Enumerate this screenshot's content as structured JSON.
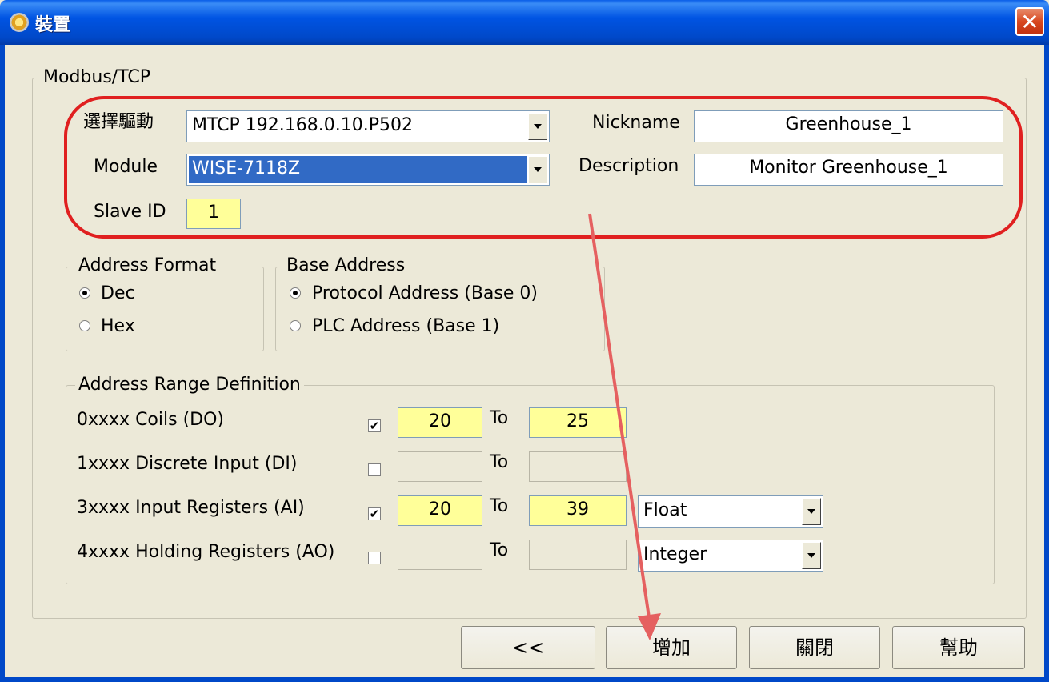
{
  "window": {
    "title": "裝置",
    "close_glyph": "✕"
  },
  "group_main": {
    "legend": "Modbus/TCP"
  },
  "driver": {
    "label": "選擇驅動",
    "value": "MTCP  192.168.0.10.P502"
  },
  "module": {
    "label": "Module",
    "value": "WISE-7118Z"
  },
  "slave": {
    "label": "Slave ID",
    "value": "1"
  },
  "nickname": {
    "label": "Nickname",
    "value": "Greenhouse_1"
  },
  "description": {
    "label": "Description",
    "value": "Monitor Greenhouse_1"
  },
  "address_format": {
    "legend": "Address Format",
    "options": [
      {
        "label": "Dec",
        "selected": true
      },
      {
        "label": "Hex",
        "selected": false
      }
    ]
  },
  "base_address": {
    "legend": "Base Address",
    "options": [
      {
        "label": "Protocol Address (Base 0)",
        "selected": true
      },
      {
        "label": "PLC Address (Base 1)",
        "selected": false
      }
    ]
  },
  "range": {
    "legend": "Address Range Definition",
    "to_label": "To",
    "rows": [
      {
        "label": "0xxxx Coils (DO)",
        "checked": true,
        "from": "20",
        "to": "25",
        "type": ""
      },
      {
        "label": "1xxxx Discrete Input (DI)",
        "checked": false,
        "from": "",
        "to": "",
        "type": ""
      },
      {
        "label": "3xxxx Input Registers (AI)",
        "checked": true,
        "from": "20",
        "to": "39",
        "type": "Float"
      },
      {
        "label": "4xxxx Holding Registers (AO)",
        "checked": false,
        "from": "",
        "to": "",
        "type": "Integer"
      }
    ]
  },
  "buttons": {
    "back": "<<",
    "add": "增加",
    "close": "關閉",
    "help": "幫助"
  },
  "colors": {
    "title_bar": "#0054e3",
    "highlight_field": "#ffff99",
    "annotation": "#e02020",
    "selection": "#316ac5"
  }
}
